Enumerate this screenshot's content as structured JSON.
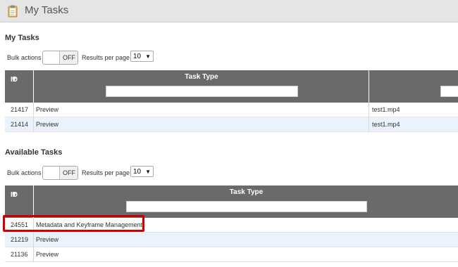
{
  "header": {
    "title": "My Tasks",
    "icon": "clipboard-icon"
  },
  "my_tasks": {
    "section_title": "My Tasks",
    "bulk_actions_label": "Bulk actions",
    "toggle_state": "OFF",
    "results_per_page_label": "Results per page",
    "results_per_page_value": "10",
    "columns": {
      "id": "ID",
      "task_type": "Task Type"
    },
    "rows": [
      {
        "id": "21417",
        "task_type": "Preview",
        "file": "test1.mp4"
      },
      {
        "id": "21414",
        "task_type": "Preview",
        "file": "test1.mp4"
      }
    ]
  },
  "available_tasks": {
    "section_title": "Available Tasks",
    "bulk_actions_label": "Bulk actions",
    "toggle_state": "OFF",
    "results_per_page_label": "Results per page",
    "results_per_page_value": "10",
    "columns": {
      "id": "ID",
      "task_type": "Task Type"
    },
    "rows": [
      {
        "id": "24551",
        "task_type": "Metadata and Keyframe Management"
      },
      {
        "id": "21219",
        "task_type": "Preview"
      },
      {
        "id": "21136",
        "task_type": "Preview"
      }
    ]
  },
  "colors": {
    "header_bar": "#e5e5e5",
    "table_header": "#6a6a6a",
    "alt_row": "#eaf3fb",
    "highlight": "#cc0000"
  }
}
